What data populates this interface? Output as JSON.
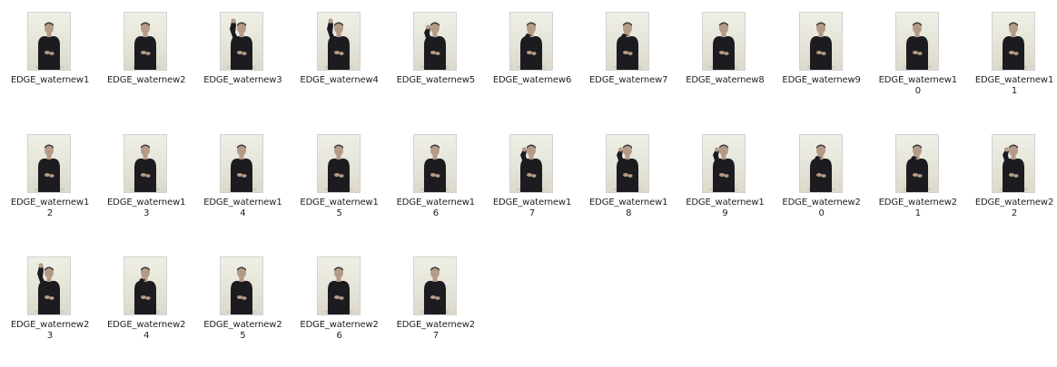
{
  "window": {
    "view": "file-explorer-large-icons"
  },
  "icon_name": "video-thumbnail-icon",
  "files": [
    {
      "name_line1": "EDGE_waternew1",
      "name_line2": "",
      "pose": "hands"
    },
    {
      "name_line1": "EDGE_waternew2",
      "name_line2": "",
      "pose": "hands"
    },
    {
      "name_line1": "EDGE_waternew3",
      "name_line2": "",
      "pose": "raised-high"
    },
    {
      "name_line1": "EDGE_waternew4",
      "name_line2": "",
      "pose": "raised-high"
    },
    {
      "name_line1": "EDGE_waternew5",
      "name_line2": "",
      "pose": "raised-mid"
    },
    {
      "name_line1": "EDGE_waternew6",
      "name_line2": "",
      "pose": "raised-chin"
    },
    {
      "name_line1": "EDGE_waternew7",
      "name_line2": "",
      "pose": "raised-chin"
    },
    {
      "name_line1": "EDGE_waternew8",
      "name_line2": "",
      "pose": "hands"
    },
    {
      "name_line1": "EDGE_waternew9",
      "name_line2": "",
      "pose": "hands"
    },
    {
      "name_line1": "EDGE_waternew1",
      "name_line2": "0",
      "pose": "hands"
    },
    {
      "name_line1": "EDGE_waternew1",
      "name_line2": "1",
      "pose": "hands"
    },
    {
      "name_line1": "EDGE_waternew1",
      "name_line2": "2",
      "pose": "hands"
    },
    {
      "name_line1": "EDGE_waternew1",
      "name_line2": "3",
      "pose": "hands"
    },
    {
      "name_line1": "EDGE_waternew1",
      "name_line2": "4",
      "pose": "hands"
    },
    {
      "name_line1": "EDGE_waternew1",
      "name_line2": "5",
      "pose": "hands"
    },
    {
      "name_line1": "EDGE_waternew1",
      "name_line2": "6",
      "pose": "hands"
    },
    {
      "name_line1": "EDGE_waternew1",
      "name_line2": "7",
      "pose": "raised-mid"
    },
    {
      "name_line1": "EDGE_waternew1",
      "name_line2": "8",
      "pose": "raised-mid"
    },
    {
      "name_line1": "EDGE_waternew1",
      "name_line2": "9",
      "pose": "raised-mid"
    },
    {
      "name_line1": "EDGE_waternew2",
      "name_line2": "0",
      "pose": "raised-chin"
    },
    {
      "name_line1": "EDGE_waternew2",
      "name_line2": "1",
      "pose": "raised-chin"
    },
    {
      "name_line1": "EDGE_waternew2",
      "name_line2": "2",
      "pose": "raised-mid"
    },
    {
      "name_line1": "EDGE_waternew2",
      "name_line2": "3",
      "pose": "raised-high"
    },
    {
      "name_line1": "EDGE_waternew2",
      "name_line2": "4",
      "pose": "raised-chin"
    },
    {
      "name_line1": "EDGE_waternew2",
      "name_line2": "5",
      "pose": "hands"
    },
    {
      "name_line1": "EDGE_waternew2",
      "name_line2": "6",
      "pose": "hands"
    },
    {
      "name_line1": "EDGE_waternew2",
      "name_line2": "7",
      "pose": "hands"
    }
  ],
  "colors": {
    "wall_top": "#efefe6",
    "wall_bottom": "#dcd9cb",
    "figure": "#1c1c20",
    "skin": "#b59a86",
    "hair": "#3b3b3e",
    "text": "#1f1f1f"
  }
}
